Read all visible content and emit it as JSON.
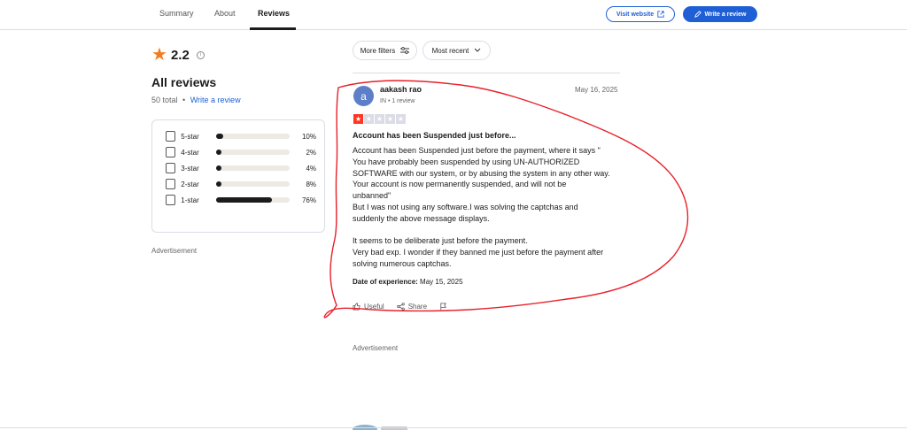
{
  "nav": {
    "tabs": [
      {
        "label": "Summary"
      },
      {
        "label": "About"
      },
      {
        "label": "Reviews"
      }
    ],
    "visit_label": "Visit website",
    "write_label": "Write a review"
  },
  "summary": {
    "rating": "2.2",
    "heading": "All reviews",
    "total": "50 total",
    "separator": "•",
    "write_link": "Write a review",
    "distribution": [
      {
        "label": "5-star",
        "pct": "10%",
        "fraction": 0.1
      },
      {
        "label": "4-star",
        "pct": "2%",
        "fraction": 0.02
      },
      {
        "label": "3-star",
        "pct": "4%",
        "fraction": 0.04
      },
      {
        "label": "2-star",
        "pct": "8%",
        "fraction": 0.08
      },
      {
        "label": "1-star",
        "pct": "76%",
        "fraction": 0.76
      }
    ],
    "ad_label": "Advertisement"
  },
  "filters": {
    "more": "More filters",
    "sort": "Most recent"
  },
  "review": {
    "avatar_letter": "a",
    "author": "aakash rao",
    "meta": "IN • 1 review",
    "date": "May 16, 2025",
    "stars": 1,
    "title": "Account has been Suspended just before...",
    "body": "Account has been Suspended just before the payment, where it says \"\nYou have probably been suspended by using UN-AUTHORIZED\nSOFTWARE with our system, or by abusing the system in any other way.\nYour account is now permanently suspended, and will not be\nunbanned\"\nBut I was not using any software.I was solving the captchas and\nsuddenly the above message displays.\n\nIt seems to be deliberate just before the payment.\nVery bad exp. I wonder if they banned me just before the payment after\nsolving numerous captchas.",
    "experience_label": "Date of experience:",
    "experience_date": "May 15, 2025",
    "useful": "Useful",
    "share": "Share"
  },
  "ad_mid": "Advertisement",
  "colors": {
    "accent": "#1f5fd6",
    "star_orange": "#f27c22",
    "star_red": "#ff3722",
    "annotation_red": "#e8202a"
  }
}
